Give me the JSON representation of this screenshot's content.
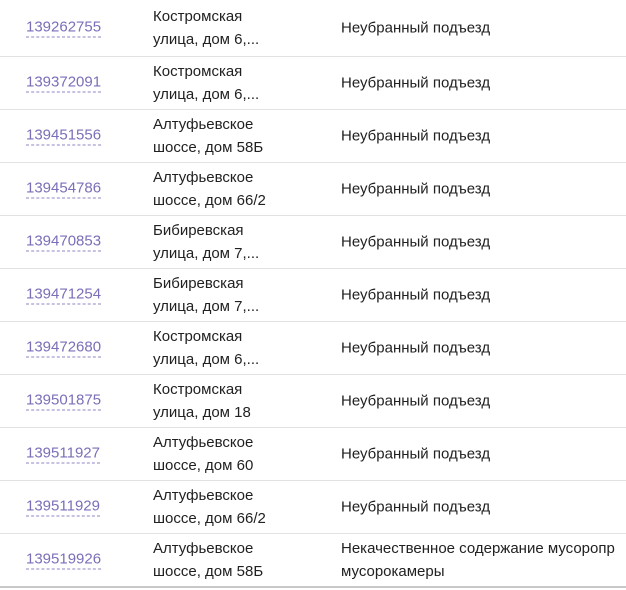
{
  "rows": [
    {
      "id": "139262755",
      "addr1": "Костромская",
      "addr2": "улица, дом 6,...",
      "type1": "Неубранный подъезд",
      "type2": ""
    },
    {
      "id": "139372091",
      "addr1": "Костромская",
      "addr2": "улица, дом 6,...",
      "type1": "Неубранный подъезд",
      "type2": ""
    },
    {
      "id": "139451556",
      "addr1": "Алтуфьевское",
      "addr2": "шоссе, дом 58Б",
      "type1": "Неубранный подъезд",
      "type2": ""
    },
    {
      "id": "139454786",
      "addr1": "Алтуфьевское",
      "addr2": "шоссе, дом 66/2",
      "type1": "Неубранный подъезд",
      "type2": ""
    },
    {
      "id": "139470853",
      "addr1": "Бибиревская",
      "addr2": "улица, дом 7,...",
      "type1": "Неубранный подъезд",
      "type2": ""
    },
    {
      "id": "139471254",
      "addr1": "Бибиревская",
      "addr2": "улица, дом 7,...",
      "type1": "Неубранный подъезд",
      "type2": ""
    },
    {
      "id": "139472680",
      "addr1": "Костромская",
      "addr2": "улица, дом 6,...",
      "type1": "Неубранный подъезд",
      "type2": ""
    },
    {
      "id": "139501875",
      "addr1": "Костромская",
      "addr2": "улица, дом 18",
      "type1": "Неубранный подъезд",
      "type2": ""
    },
    {
      "id": "139511927",
      "addr1": "Алтуфьевское",
      "addr2": "шоссе, дом 60",
      "type1": "Неубранный подъезд",
      "type2": ""
    },
    {
      "id": "139511929",
      "addr1": "Алтуфьевское",
      "addr2": "шоссе, дом 66/2",
      "type1": "Неубранный подъезд",
      "type2": ""
    },
    {
      "id": "139519926",
      "addr1": "Алтуфьевское",
      "addr2": "шоссе, дом 58Б",
      "type1": "Некачественное содержание мусоропр",
      "type2": "мусорокамеры"
    }
  ]
}
